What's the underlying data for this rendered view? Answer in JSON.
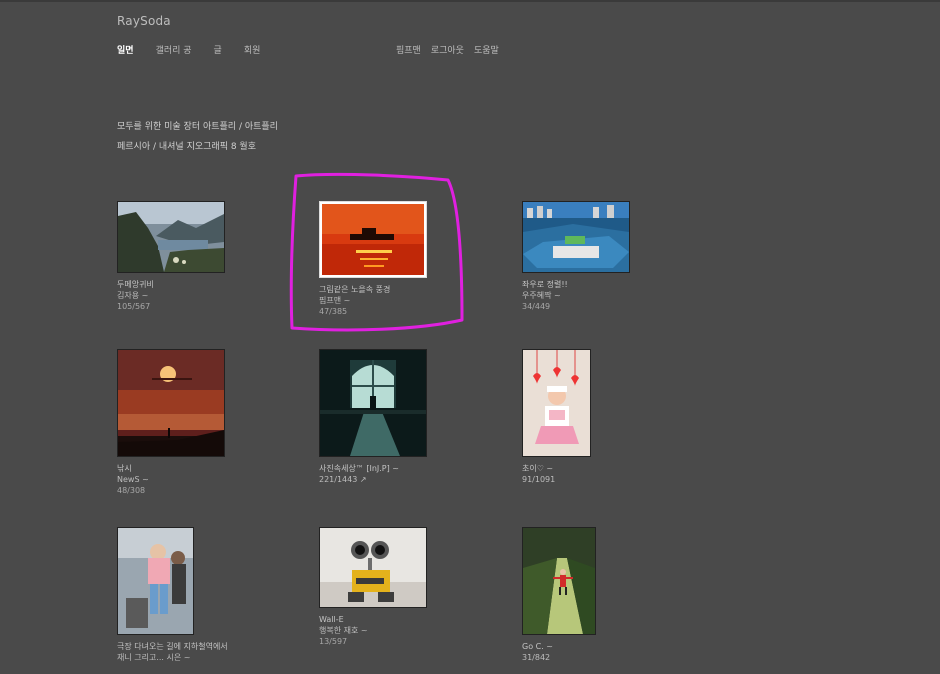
{
  "site": {
    "logo": "RaySoda"
  },
  "nav": {
    "main": [
      "일면",
      "갤러리 공",
      "글",
      "회원"
    ],
    "user": [
      "핌프맨",
      "로그아웃",
      "도움말"
    ]
  },
  "intro": {
    "line1": "모두를 위한 미술 장터 아트플리 / 아트플리",
    "line2": "페르시아 / 내셔널 지오그래픽 8 월호"
  },
  "gallery": [
    {
      "title": "두메앙귀비",
      "author": "김자용 ~",
      "count": "105/567",
      "thumb": "mountain-lake"
    },
    {
      "title": "그림같은 노을속 풍경",
      "author": "핌프맨 ~",
      "count": "47/385",
      "thumb": "sunset-boat"
    },
    {
      "title": "좌우로 정렬!!",
      "author": "우주혜짝 ~",
      "count": "34/449",
      "thumb": "parking-lot"
    },
    {
      "title": "낚시",
      "author": "NewS ~",
      "count": "48/308",
      "thumb": "sunset-fisher"
    },
    {
      "title": "사진속세상™ [InJ.P] ~",
      "author": "221/1443 ↗",
      "count": "",
      "thumb": "window-silhouette"
    },
    {
      "title": "초이♡ ~",
      "author": "91/1091",
      "count": "",
      "thumb": "child-hearts"
    },
    {
      "title": "극장 다녀오는 길에 지하철역에서",
      "author": "재니 그리고... 시은 ~",
      "count": "",
      "thumb": "family-photo"
    },
    {
      "title": "Wall-E",
      "author": "행복한 재호 ~",
      "count": "13/597",
      "thumb": "walle-toy"
    },
    {
      "title": "Go C. ~",
      "author": "31/842",
      "count": "",
      "thumb": "child-path"
    }
  ],
  "colors": {
    "background": "#4a4a4a",
    "highlight": "#e020e0",
    "active_nav": "#ffffff"
  }
}
